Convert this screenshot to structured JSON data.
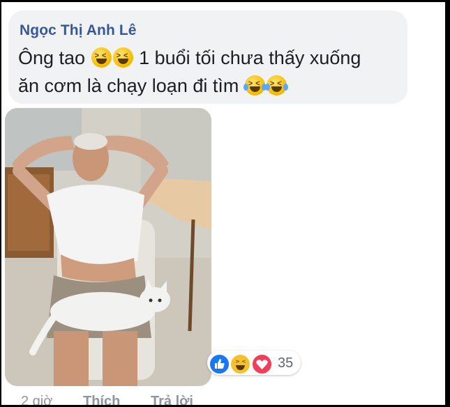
{
  "comment": {
    "author": "Ngọc Thị Anh Lê",
    "text_part1": "Ông tao",
    "text_part2": "1 buổi tối chưa thấy xuống",
    "text_part3": "ăn cơm là chạy loạn đi tìm",
    "emojis": [
      "laughing-emoji",
      "laughing-emoji",
      "tears-of-joy-emoji",
      "tears-of-joy-emoji"
    ]
  },
  "reactions": {
    "icons": [
      "like-icon",
      "haha-icon",
      "love-icon"
    ],
    "count": "35",
    "colors": {
      "like": "#1877f2",
      "haha": "#f7c12e",
      "love": "#f33e58"
    }
  },
  "footer": {
    "time": "2 giờ",
    "like_label": "Thích",
    "reply_label": "Trả lời"
  },
  "colors": {
    "author": "#365899",
    "bubble": "#f1f2f4",
    "meta": "#90949c"
  }
}
